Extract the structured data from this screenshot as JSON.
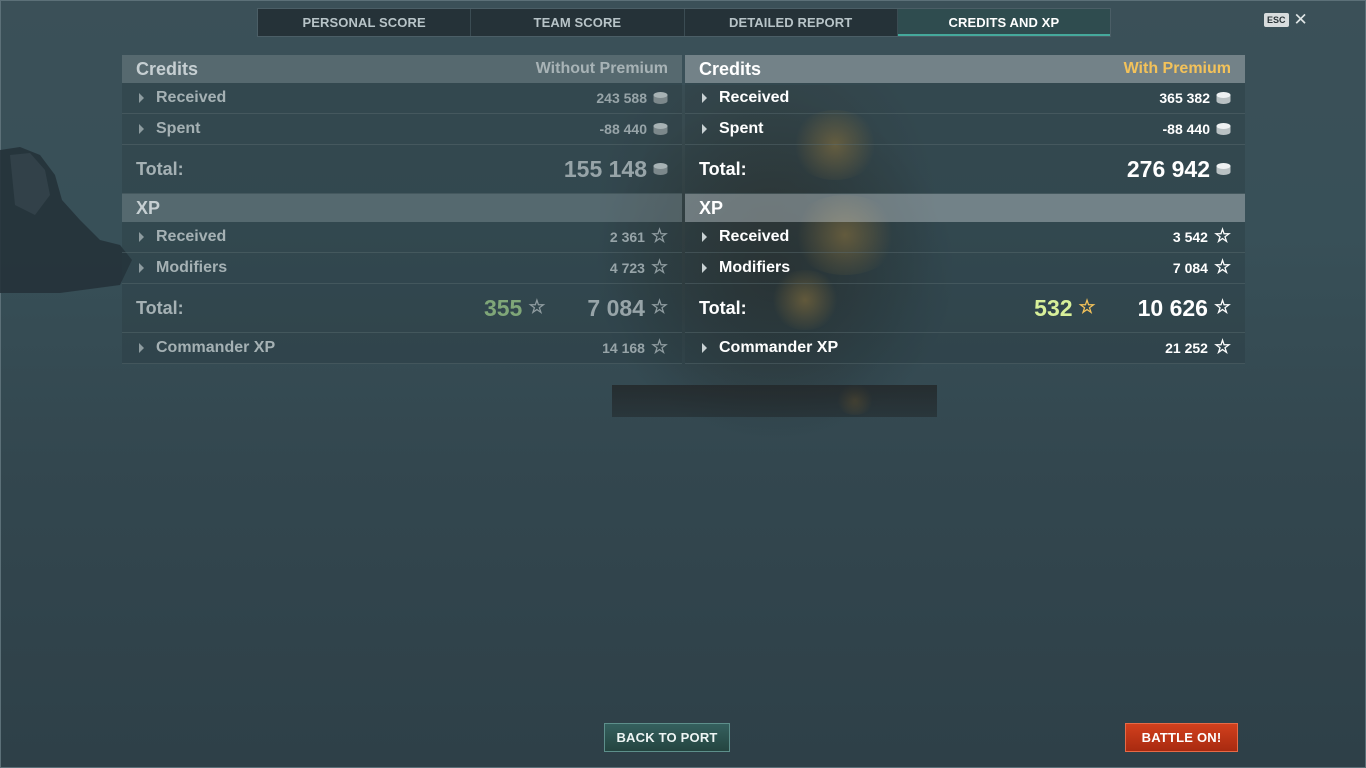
{
  "tabs": [
    {
      "label": "PERSONAL SCORE"
    },
    {
      "label": "TEAM SCORE"
    },
    {
      "label": "DETAILED REPORT"
    },
    {
      "label": "CREDITS AND XP"
    }
  ],
  "active_tab": "CREDITS AND XP",
  "esc": {
    "key": "ESC"
  },
  "without_premium": {
    "credits_title": "Credits",
    "subtitle": "Without Premium",
    "credits": {
      "received": {
        "label": "Received",
        "value": "243 588"
      },
      "spent": {
        "label": "Spent",
        "value": "-88 440"
      },
      "total": {
        "label": "Total:",
        "value": "155 148"
      }
    },
    "xp_title": "XP",
    "xp": {
      "received": {
        "label": "Received",
        "value": "2 361"
      },
      "modifiers": {
        "label": "Modifiers",
        "value": "4 723"
      },
      "total": {
        "label": "Total:",
        "premium_value": "355",
        "value": "7 084"
      },
      "commander": {
        "label": "Commander XP",
        "value": "14 168"
      }
    }
  },
  "with_premium": {
    "credits_title": "Credits",
    "subtitle": "With Premium",
    "credits": {
      "received": {
        "label": "Received",
        "value": "365 382"
      },
      "spent": {
        "label": "Spent",
        "value": "-88 440"
      },
      "total": {
        "label": "Total:",
        "value": "276 942"
      }
    },
    "xp_title": "XP",
    "xp": {
      "received": {
        "label": "Received",
        "value": "3 542"
      },
      "modifiers": {
        "label": "Modifiers",
        "value": "7 084"
      },
      "total": {
        "label": "Total:",
        "premium_value": "532",
        "value": "10 626"
      },
      "commander": {
        "label": "Commander XP",
        "value": "21 252"
      }
    }
  },
  "buttons": {
    "back_to_port": "BACK TO PORT",
    "battle_on": "BATTLE ON!"
  },
  "icons": {
    "credits": "credits-coin-icon",
    "xp": "xp-star-icon",
    "close": "close-icon"
  },
  "colors": {
    "premium_accent": "#f3c25a",
    "active_tab_accent": "#45a99c",
    "battle_button": "#c8381a",
    "premium_xp": "#d8f09a"
  }
}
